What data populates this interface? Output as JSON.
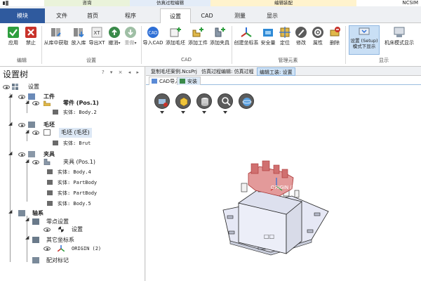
{
  "window": {
    "brand": "NCSIM",
    "context_groups": [
      {
        "label": "咨询"
      },
      {
        "label": "仿真过程编辑"
      },
      {
        "label": "编辑装配"
      }
    ]
  },
  "tabs": {
    "module": "模块",
    "items": [
      {
        "label": "文件"
      },
      {
        "label": "首页"
      },
      {
        "label": "程序"
      },
      {
        "label": "设置"
      },
      {
        "label": "CAD"
      },
      {
        "label": "测量"
      },
      {
        "label": "显示"
      }
    ],
    "active": "设置"
  },
  "ribbon": {
    "groups": {
      "edit": "编辑",
      "settings": "设置",
      "cad": "CAD",
      "management": "管理元素",
      "display": "显示"
    },
    "buttons": {
      "apply": "应用",
      "disable": "禁止",
      "from_library": "从库中获取",
      "put_library": "放入库",
      "export_xt": "导出XT",
      "undo": "撤消",
      "redo": "重做",
      "import_cad": "导入CAD",
      "add_blank": "添加毛坯",
      "add_part": "添加工件",
      "add_fixture": "添加夹具",
      "create_coord": "创建坐标系",
      "safety": "安全量",
      "locate": "定位",
      "modify": "修改",
      "properties": "属性",
      "delete": "删除",
      "setup_mode": "设置 (Setup)",
      "setup_mode_sub": "模式下显示",
      "machine_mode": "机床模式显示"
    },
    "colors": {
      "apply": "#2e9e3e",
      "disable": "#c8322a",
      "module_bg": "#2f5a9e"
    }
  },
  "tree": {
    "title": "设置树",
    "controls": "? ▾ × ◂ ▸",
    "nodes": {
      "root": "设置",
      "workpiece": "工件",
      "part": "零件 (Pos.1)",
      "part_entity": "实体: Body.2",
      "blank": "毛坯",
      "blank_item": "毛坯 (毛坯)",
      "blank_entity": "实体: Brut",
      "fixture": "夹具",
      "fixture_item": "夹具 (Pos.1)",
      "fx_entity1": "实体: Body.4",
      "fx_entity2": "实体: PartBody",
      "fx_entity3": "实体: PartBody",
      "fx_entity4": "实体: Body.5",
      "axis": "轴系",
      "zero_setup": "零点设置",
      "setup_leaf": "设置",
      "other_coord": "其它坐标系",
      "origin": "ORIGIN (2)",
      "cal_mark": "配对标记"
    }
  },
  "documents": {
    "tabs": [
      {
        "label": "复制毛坯案例.NcsPrj"
      },
      {
        "label": "仿真过程编辑: 仿真过程"
      },
      {
        "label": "编辑工装: 设置"
      }
    ],
    "active": "编辑工装: 设置",
    "subtabs": [
      {
        "label": "CAD导入"
      },
      {
        "label": "安装"
      }
    ],
    "active_subtab": "安装"
  },
  "viewport": {
    "origin_label": "ORIGIN (2)",
    "face_label": "□□",
    "tool_icons": [
      "import-view-icon",
      "box-icon",
      "cylinder-icon",
      "search-icon",
      "sphere-icon"
    ]
  }
}
